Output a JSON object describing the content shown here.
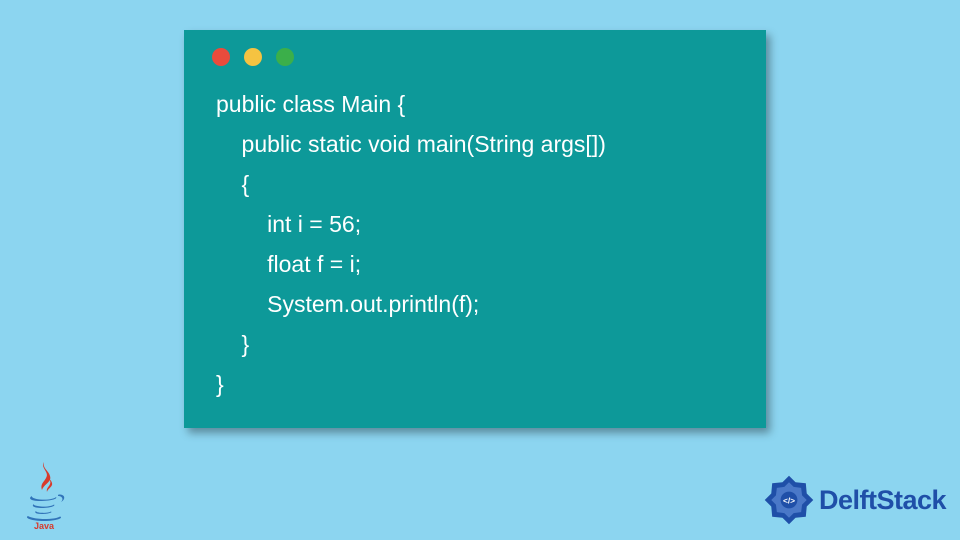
{
  "code": {
    "lines": [
      "public class Main {",
      "    public static void main(String args[])",
      "    {",
      "        int i = 56;",
      "        float f = i;",
      "        System.out.println(f);",
      "    }",
      "}"
    ]
  },
  "footer": {
    "java_label": "Java",
    "brand": "DelftStack"
  },
  "colors": {
    "background": "#8CD5F0",
    "window": "#0D9999",
    "red": "#E94B3C",
    "yellow": "#F5C341",
    "green": "#3BAF4A",
    "brand_blue": "#1F4FA8"
  }
}
